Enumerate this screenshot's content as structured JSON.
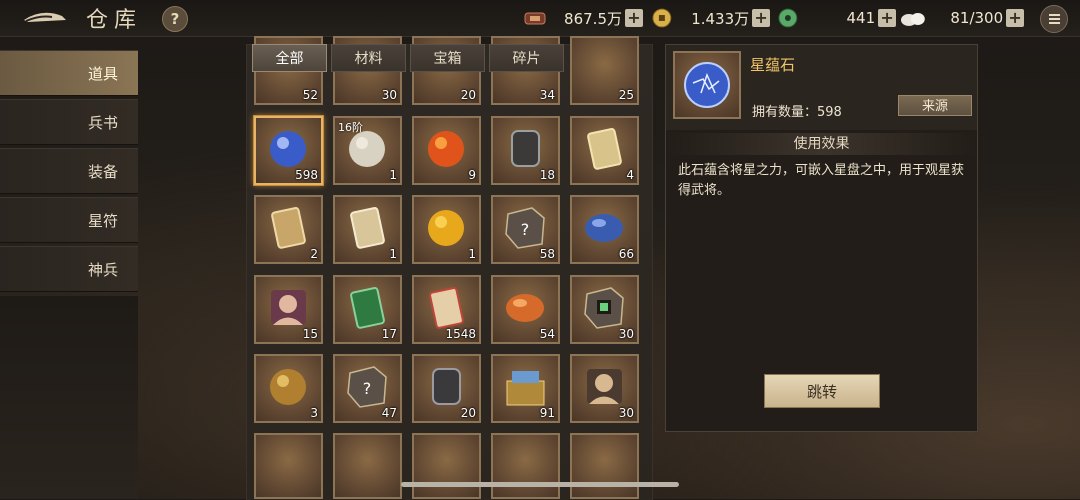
{
  "header": {
    "title": "仓库",
    "help_label": "?",
    "resources": [
      {
        "icon": "scroll-token-icon",
        "value": "867.5万"
      },
      {
        "icon": "coin-icon",
        "value": "1.433万"
      },
      {
        "icon": "jade-icon",
        "value": "441"
      },
      {
        "icon": "steamed-bun-icon",
        "value": "81/300"
      }
    ],
    "plus_label": "+"
  },
  "sidebar": {
    "items": [
      {
        "label": "道具",
        "active": true
      },
      {
        "label": "兵书"
      },
      {
        "label": "装备"
      },
      {
        "label": "星符"
      },
      {
        "label": "神兵"
      }
    ]
  },
  "tabs": [
    {
      "label": "全部",
      "active": true
    },
    {
      "label": "材料"
    },
    {
      "label": "宝箱"
    },
    {
      "label": "碎片"
    }
  ],
  "items": {
    "partial_top": [
      "52",
      "30",
      "20",
      "34",
      "25"
    ],
    "rows": [
      [
        {
          "icon": "star-stone-icon",
          "count": "598",
          "selected": true
        },
        {
          "icon": "jade-pendant-icon",
          "count": "1",
          "badge": "16阶"
        },
        {
          "icon": "flame-orb-icon",
          "count": "9"
        },
        {
          "icon": "compass-sword-icon",
          "count": "18"
        },
        {
          "icon": "scroll-icon",
          "count": "4"
        }
      ],
      [
        {
          "icon": "paper-note-icon",
          "count": "2"
        },
        {
          "icon": "rolled-scroll-icon",
          "count": "1"
        },
        {
          "icon": "amber-gem-icon",
          "count": "1"
        },
        {
          "icon": "mystery-fragment-icon",
          "count": "58"
        },
        {
          "icon": "blue-bean-icon",
          "count": "66"
        }
      ],
      [
        {
          "icon": "general-portrait-icon",
          "count": "15"
        },
        {
          "icon": "green-scroll-icon",
          "count": "17"
        },
        {
          "icon": "red-card-icon",
          "count": "1548"
        },
        {
          "icon": "orange-bean-icon",
          "count": "54"
        },
        {
          "icon": "shu-fragment-icon",
          "count": "30"
        }
      ],
      [
        {
          "icon": "gold-ring-icon",
          "count": "3"
        },
        {
          "icon": "mystery-fragment-icon",
          "count": "47"
        },
        {
          "icon": "iron-token-icon",
          "count": "20"
        },
        {
          "icon": "treasure-chest-icon",
          "count": "91"
        },
        {
          "icon": "warrior-portrait-icon",
          "count": "30"
        }
      ]
    ]
  },
  "detail": {
    "name": "星蕴石",
    "quantity": "拥有数量：598",
    "source_label": "来源",
    "use_header": "使用效果",
    "description": "此石蕴含将星之力，可嵌入星盘之中，用于观星获得武将。",
    "jump_label": "跳转"
  }
}
